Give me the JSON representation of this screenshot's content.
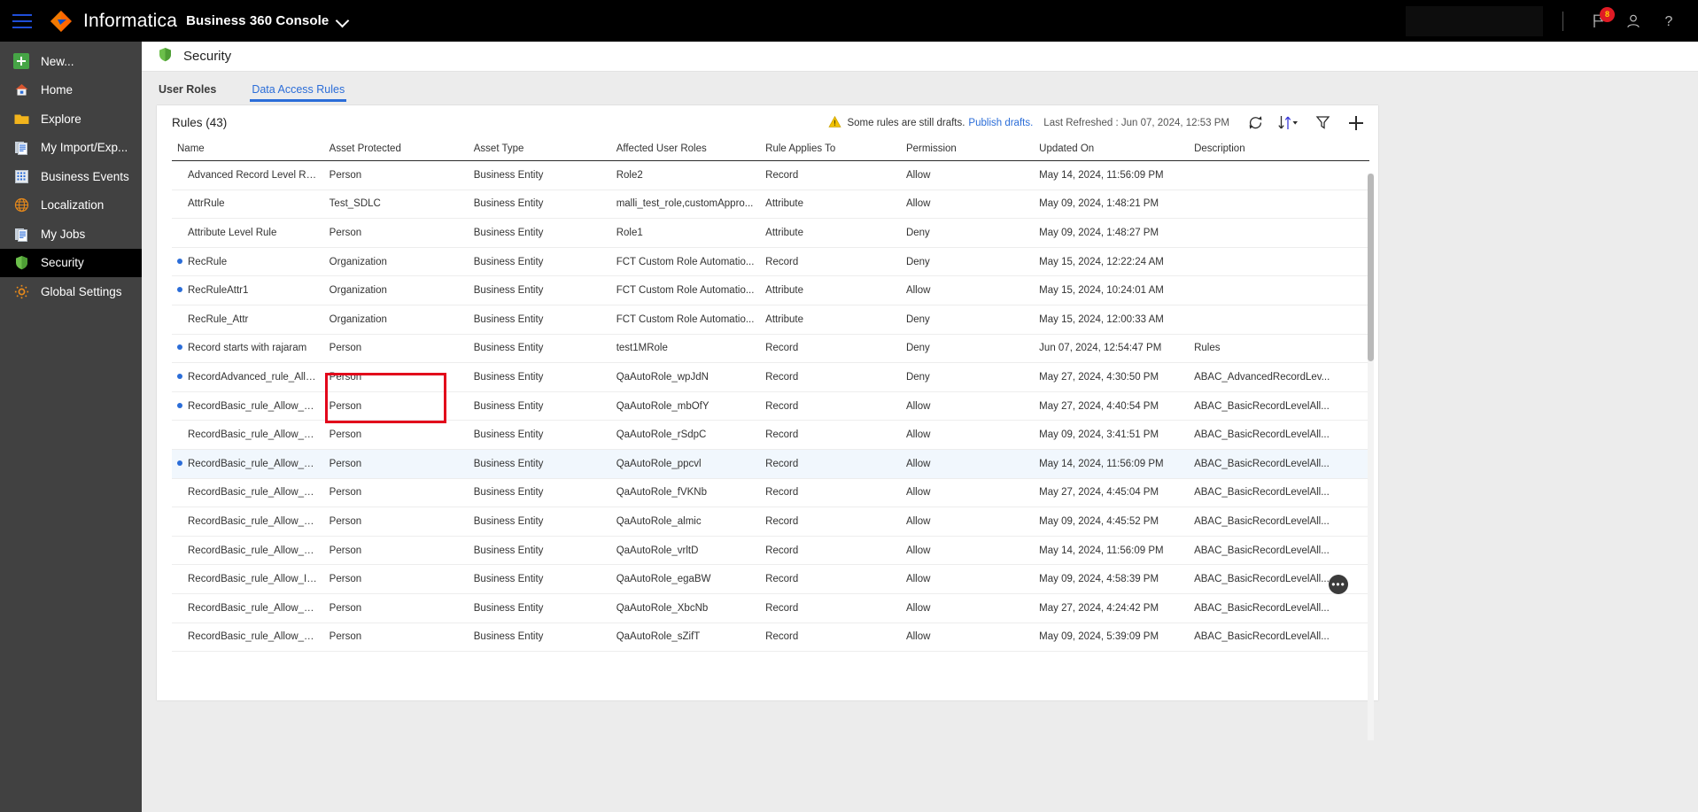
{
  "topbar": {
    "menu_icon": "hamburger-icon",
    "brand": "Informatica",
    "app_name": "Business 360 Console",
    "chevron_icon": "chevron-down-icon",
    "notification_badge": "8",
    "icons": [
      "flag-icon",
      "user-icon",
      "help-icon"
    ],
    "accent": "#1f4ed8"
  },
  "sidebar": {
    "items": [
      {
        "label": "New...",
        "icon": "plus-icon",
        "active": false
      },
      {
        "label": "Home",
        "icon": "home-icon",
        "active": false
      },
      {
        "label": "Explore",
        "icon": "folder-icon",
        "active": false
      },
      {
        "label": "My Import/Exp...",
        "icon": "documents-icon",
        "active": false
      },
      {
        "label": "Business Events",
        "icon": "grid-icon",
        "active": false
      },
      {
        "label": "Localization",
        "icon": "globe-icon",
        "active": false
      },
      {
        "label": "My Jobs",
        "icon": "documents-icon",
        "active": false
      },
      {
        "label": "Security",
        "icon": "shield-icon",
        "active": true
      },
      {
        "label": "Global Settings",
        "icon": "gear-icon",
        "active": false
      }
    ]
  },
  "page": {
    "title": "Security",
    "title_icon": "shield-icon",
    "tabs": [
      {
        "label": "User Roles",
        "active": false
      },
      {
        "label": "Data Access Rules",
        "active": true
      }
    ]
  },
  "toolbar": {
    "rules_count_label": "Rules (43)",
    "warning_icon": "warning-triangle-icon",
    "draft_message": "Some rules are still drafts.",
    "publish_link": "Publish drafts.",
    "last_refreshed": "Last Refreshed : Jun 07, 2024, 12:53 PM",
    "refresh_icon": "refresh-icon",
    "sort_icon": "sort-icon",
    "filter_icon": "filter-icon",
    "add_icon": "add-icon"
  },
  "table": {
    "columns": [
      "Name",
      "Asset Protected",
      "Asset Type",
      "Affected User Roles",
      "Rule Applies To",
      "Permission",
      "Updated On",
      "Description"
    ],
    "rows": [
      {
        "draft": false,
        "name": "Advanced Record Level Rule",
        "asset": "Person",
        "type": "Business Entity",
        "roles": "Role2",
        "applies": "Record",
        "permission": "Allow",
        "updated": "May 14, 2024, 11:56:09 PM",
        "description": ""
      },
      {
        "draft": false,
        "name": "AttrRule",
        "asset": "Test_SDLC",
        "type": "Business Entity",
        "roles": "malli_test_role,customAppro...",
        "applies": "Attribute",
        "permission": "Allow",
        "updated": "May 09, 2024, 1:48:21 PM",
        "description": ""
      },
      {
        "draft": false,
        "name": "Attribute Level Rule",
        "asset": "Person",
        "type": "Business Entity",
        "roles": "Role1",
        "applies": "Attribute",
        "permission": "Deny",
        "updated": "May 09, 2024, 1:48:27 PM",
        "description": ""
      },
      {
        "draft": true,
        "name": "RecRule",
        "asset": "Organization",
        "type": "Business Entity",
        "roles": "FCT Custom Role Automatio...",
        "applies": "Record",
        "permission": "Deny",
        "updated": "May 15, 2024, 12:22:24 AM",
        "description": ""
      },
      {
        "draft": true,
        "name": "RecRuleAttr1",
        "asset": "Organization",
        "type": "Business Entity",
        "roles": "FCT Custom Role Automatio...",
        "applies": "Attribute",
        "permission": "Allow",
        "updated": "May 15, 2024, 10:24:01 AM",
        "description": ""
      },
      {
        "draft": false,
        "name": "RecRule_Attr",
        "asset": "Organization",
        "type": "Business Entity",
        "roles": "FCT Custom Role Automatio...",
        "applies": "Attribute",
        "permission": "Deny",
        "updated": "May 15, 2024, 12:00:33 AM",
        "description": ""
      },
      {
        "draft": true,
        "name": "Record starts with rajaram",
        "asset": "Person",
        "type": "Business Entity",
        "roles": "test1MRole",
        "applies": "Record",
        "permission": "Deny",
        "updated": "Jun 07, 2024, 12:54:47 PM",
        "description": "Rules"
      },
      {
        "draft": true,
        "name": "RecordAdvanced_rule_Allo...",
        "asset": "Person",
        "type": "Business Entity",
        "roles": "QaAutoRole_wpJdN",
        "applies": "Record",
        "permission": "Deny",
        "updated": "May 27, 2024, 4:30:50 PM",
        "description": "ABAC_AdvancedRecordLev..."
      },
      {
        "draft": true,
        "name": "RecordBasic_rule_Allow_AT...",
        "asset": "Person",
        "type": "Business Entity",
        "roles": "QaAutoRole_mbOfY",
        "applies": "Record",
        "permission": "Allow",
        "updated": "May 27, 2024, 4:40:54 PM",
        "description": "ABAC_BasicRecordLevelAll..."
      },
      {
        "draft": false,
        "name": "RecordBasic_rule_Allow_A...",
        "asset": "Person",
        "type": "Business Entity",
        "roles": "QaAutoRole_rSdpC",
        "applies": "Record",
        "permission": "Allow",
        "updated": "May 09, 2024, 3:41:51 PM",
        "description": "ABAC_BasicRecordLevelAll..."
      },
      {
        "draft": true,
        "name": "RecordBasic_rule_Allow_C...",
        "asset": "Person",
        "type": "Business Entity",
        "roles": "QaAutoRole_ppcvl",
        "applies": "Record",
        "permission": "Allow",
        "updated": "May 14, 2024, 11:56:09 PM",
        "description": "ABAC_BasicRecordLevelAll...",
        "highlight": true
      },
      {
        "draft": false,
        "name": "RecordBasic_rule_Allow_D...",
        "asset": "Person",
        "type": "Business Entity",
        "roles": "QaAutoRole_fVKNb",
        "applies": "Record",
        "permission": "Allow",
        "updated": "May 27, 2024, 4:45:04 PM",
        "description": "ABAC_BasicRecordLevelAll..."
      },
      {
        "draft": false,
        "name": "RecordBasic_rule_Allow_D...",
        "asset": "Person",
        "type": "Business Entity",
        "roles": "QaAutoRole_almic",
        "applies": "Record",
        "permission": "Allow",
        "updated": "May 09, 2024, 4:45:52 PM",
        "description": "ABAC_BasicRecordLevelAll..."
      },
      {
        "draft": false,
        "name": "RecordBasic_rule_Allow_G...",
        "asset": "Person",
        "type": "Business Entity",
        "roles": "QaAutoRole_vrltD",
        "applies": "Record",
        "permission": "Allow",
        "updated": "May 14, 2024, 11:56:09 PM",
        "description": "ABAC_BasicRecordLevelAll..."
      },
      {
        "draft": false,
        "name": "RecordBasic_rule_Allow_Ijcg",
        "asset": "Person",
        "type": "Business Entity",
        "roles": "QaAutoRole_egaBW",
        "applies": "Record",
        "permission": "Allow",
        "updated": "May 09, 2024, 4:58:39 PM",
        "description": "ABAC_BasicRecordLevelAll..."
      },
      {
        "draft": false,
        "name": "RecordBasic_rule_Allow_Jlim",
        "asset": "Person",
        "type": "Business Entity",
        "roles": "QaAutoRole_XbcNb",
        "applies": "Record",
        "permission": "Allow",
        "updated": "May 27, 2024, 4:24:42 PM",
        "description": "ABAC_BasicRecordLevelAll..."
      },
      {
        "draft": false,
        "name": "RecordBasic_rule_Allow_K...",
        "asset": "Person",
        "type": "Business Entity",
        "roles": "QaAutoRole_sZifT",
        "applies": "Record",
        "permission": "Allow",
        "updated": "May 09, 2024, 5:39:09 PM",
        "description": "ABAC_BasicRecordLevelAll..."
      }
    ],
    "row_actions_label": "•••"
  },
  "colors": {
    "link": "#2b6dd8",
    "sidebar_bg": "#414141",
    "topbar_bg": "#000000",
    "highlight_box": "#e2041b",
    "warning": "#f2c200",
    "shield_green": "#6cbf4b"
  }
}
